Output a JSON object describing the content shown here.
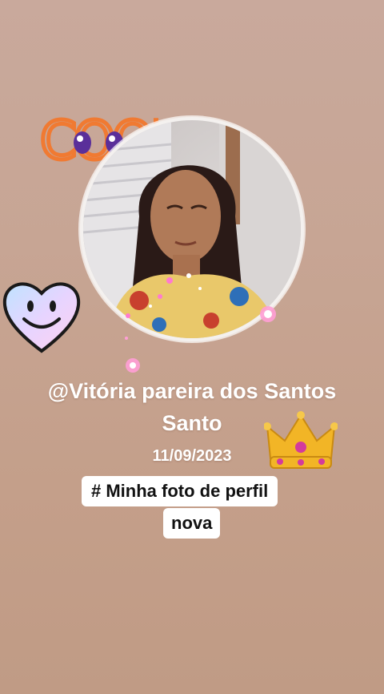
{
  "stickers": {
    "cool_text": "COOL",
    "cool_color": "#f07a32",
    "heart_icon": "smiley-heart-icon",
    "crown_icon": "crown-icon"
  },
  "profile": {
    "username": "@Vitória pareira dos Santos Santo",
    "date": "11/09/2023"
  },
  "caption": {
    "line1": "# Minha foto de perfil",
    "line2": "nova"
  },
  "colors": {
    "background": "#c7a594",
    "text": "#ffffff",
    "caption_bg": "#ffffff"
  }
}
